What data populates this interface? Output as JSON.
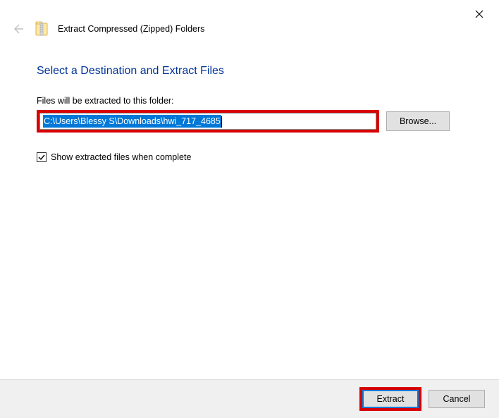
{
  "window": {
    "title": "Extract Compressed (Zipped) Folders"
  },
  "heading": "Select a Destination and Extract Files",
  "label": "Files will be extracted to this folder:",
  "path": "C:\\Users\\Blessy S\\Downloads\\hwi_717_4685",
  "browse": "Browse...",
  "checkbox": {
    "checked": true,
    "label": "Show extracted files when complete"
  },
  "buttons": {
    "extract": "Extract",
    "cancel": "Cancel"
  }
}
